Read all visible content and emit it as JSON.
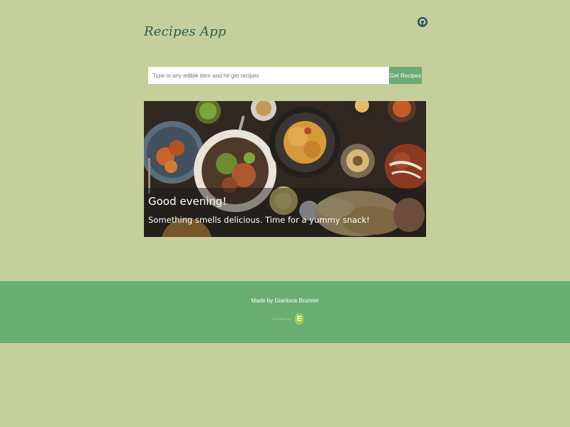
{
  "header": {
    "brand": "Recipes App",
    "github_icon": "github-icon"
  },
  "search": {
    "placeholder": "Type in any edible item and hit get recipes",
    "value": "",
    "button_label": "Get Recipes"
  },
  "hero": {
    "greeting": "Good evening!",
    "message": "Something smells delicious. Time for a yummy snack!"
  },
  "footer": {
    "credit": "Made by Gianluca Brunner",
    "powered_by": "POWERED BY",
    "powered_logo_letter": "E"
  },
  "colors": {
    "background": "#c5cf9b",
    "accent": "#6aae74",
    "brand_text": "#2f5e4a"
  }
}
